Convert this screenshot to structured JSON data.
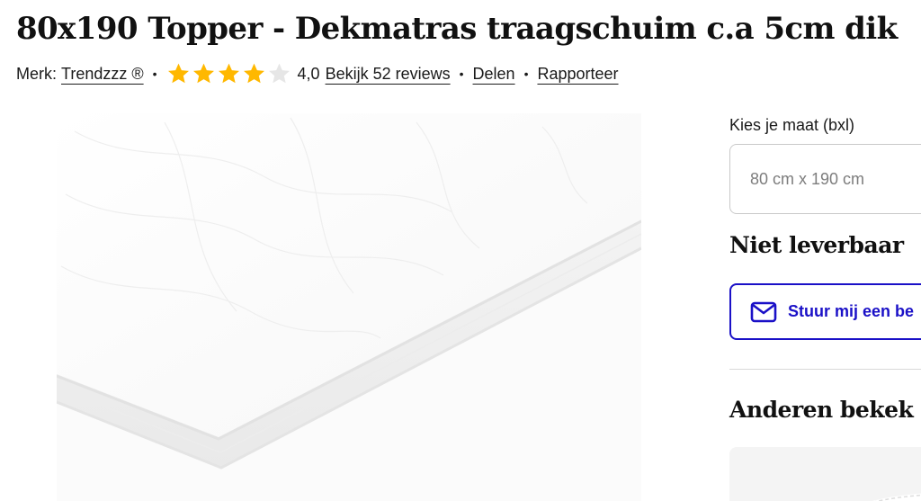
{
  "product": {
    "title": "80x190 Topper - Dekmatras traagschuim c.a 5cm dik"
  },
  "meta": {
    "brand_label": "Merk:",
    "brand_name": "Trendzzz ®",
    "rating": 4.0,
    "rating_max": 5,
    "rating_text": "4,0",
    "reviews_link": "Bekijk 52 reviews",
    "share_link": "Delen",
    "report_link": "Rapporteer",
    "separator": "•",
    "star_color": "#ffb800",
    "star_empty_color": "#e6e6e6"
  },
  "image": {
    "icon": "mattress-topper-image"
  },
  "size_selector": {
    "label": "Kies je maat (bxl)",
    "value": "80 cm x 190 cm"
  },
  "availability": {
    "status": "Niet leverbaar"
  },
  "notify": {
    "label": "Stuur mij een be",
    "icon": "mail-icon",
    "color": "#1a10c7"
  },
  "others": {
    "heading": "Anderen bekek"
  }
}
